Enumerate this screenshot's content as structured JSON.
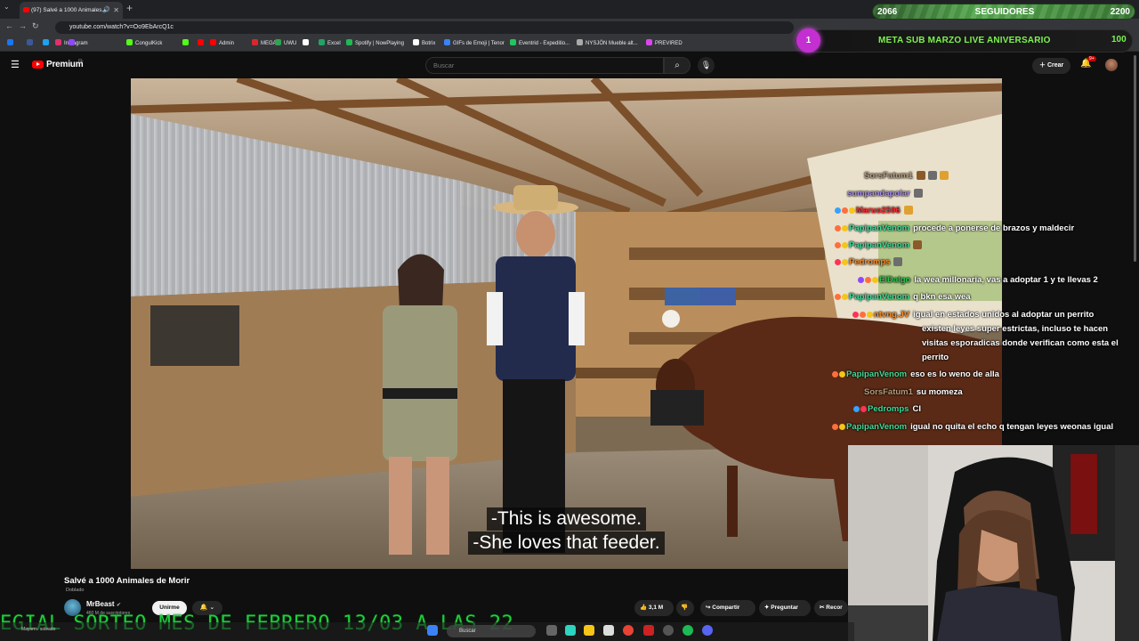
{
  "browser": {
    "tab_title": "(97) Salvé a 1000 Animales...",
    "url": "youtube.com/watch?v=Oo9EbArcQ1c",
    "new_tab": "+",
    "bookmarks": [
      {
        "label": "",
        "color": "#1877f2"
      },
      {
        "label": "",
        "color": "#3b5998"
      },
      {
        "label": "",
        "color": "#1da1f2"
      },
      {
        "label": "Instagram",
        "color": "#e1306c"
      },
      {
        "label": "",
        "color": "#9146ff"
      },
      {
        "label": "CongulKick",
        "color": "#53fc18"
      },
      {
        "label": "",
        "color": "#53fc18"
      },
      {
        "label": "",
        "color": "#ff0000"
      },
      {
        "label": "Admin",
        "color": "#ff0000"
      },
      {
        "label": "MEGA",
        "color": "#d9272e"
      },
      {
        "label": "UWU",
        "color": "#2ea44f"
      },
      {
        "label": "",
        "color": "#ffffff"
      },
      {
        "label": "Excel",
        "color": "#21a366"
      },
      {
        "label": "Spotify | NowPlaying",
        "color": "#1db954"
      },
      {
        "label": "Botrix",
        "color": "#ffffff"
      },
      {
        "label": "GIFs de Emoji | Tenor",
        "color": "#3b82f6"
      },
      {
        "label": "Eventrid - Expeditio...",
        "color": "#22c55e"
      },
      {
        "label": "NYSJÖN Mueble alt...",
        "color": "#aaaaaa"
      },
      {
        "label": "PREVIRED",
        "color": "#d946ef"
      }
    ]
  },
  "youtube": {
    "brand": "Premium",
    "brand_region": "CL",
    "search_placeholder": "Buscar",
    "create_label": "Crear",
    "bell_badge": "9+",
    "video_title": "Salvé a 1000 Animales de Morir",
    "dubbed_label": "Doblado",
    "channel_name": "MrBeast",
    "channel_subs": "460 M de suscriptores",
    "join_label": "Unirme",
    "likes": "3,1 M",
    "share_label": "Compartir",
    "ask_label": "Preguntar",
    "clip_label": "Recor",
    "subtitles": [
      "-This is awesome.",
      "-She loves that feeder."
    ]
  },
  "overlay": {
    "followers_current": "2066",
    "followers_label": "SEGUIDORES",
    "followers_goal": "2200",
    "sub_count": "1",
    "sub_goal_title": "META SUB MARZO LIVE ANIVERSARIO",
    "sub_goal_target": "100",
    "ticker": "EGIAL SORTEO MES DE FEBRERO 13/03 A LAS 22"
  },
  "chat": [
    {
      "name": "SorsFatum1",
      "name_color": "#b59b7c",
      "text": "",
      "emotes": 3,
      "badges": []
    },
    {
      "name": "sumpandapolar",
      "name_color": "#a98be8",
      "text": "",
      "emotes": 1,
      "badges": []
    },
    {
      "name": "Maruo2506",
      "name_color": "#ff2a2a",
      "text": "",
      "emotes": 1,
      "badges": [
        "#35a2ff",
        "#ff6f3c",
        "#f5c518"
      ]
    },
    {
      "name": "PapipanVenom",
      "name_color": "#3ddc9a",
      "text": "procede a ponerse de brazos y maldecir",
      "emotes": 0,
      "badges": [
        "#ff6f3c",
        "#f5c518"
      ]
    },
    {
      "name": "PapipanVenom",
      "name_color": "#3ddc9a",
      "text": "",
      "emotes": 1,
      "badges": [
        "#ff6f3c",
        "#f5c518"
      ]
    },
    {
      "name": "Pedromps",
      "name_color": "#ff8a1f",
      "text": "",
      "emotes": 1,
      "badges": [
        "#ff3355",
        "#f5c518"
      ]
    },
    {
      "name": "ElDalgo",
      "name_color": "#27c64a",
      "text": "la wea millonaria, vas a adoptar 1 y te llevas 2",
      "emotes": 0,
      "badges": [
        "#9146ff",
        "#ff6f3c",
        "#f5c518"
      ]
    },
    {
      "name": "PapipanVenom",
      "name_color": "#3ddc9a",
      "text": "q bkn esa wea",
      "emotes": 0,
      "badges": [
        "#ff6f3c",
        "#f5c518"
      ]
    },
    {
      "name": "ntvng.JV",
      "name_color": "#ff8a1f",
      "text": "igual en estados unidos al adoptar un perrito",
      "emotes": 0,
      "badges": [
        "#ff3355",
        "#ff6f3c",
        "#f5c518"
      ]
    },
    {
      "name": "",
      "name_color": "#ffffff",
      "text": "existen leyes super estrictas, incluso te hacen",
      "emotes": 0,
      "badges": []
    },
    {
      "name": "",
      "name_color": "#ffffff",
      "text": "visitas esporadicas donde verifican como esta el",
      "emotes": 0,
      "badges": []
    },
    {
      "name": "",
      "name_color": "#ffffff",
      "text": "perrito",
      "emotes": 0,
      "badges": []
    },
    {
      "name": "PapipanVenom",
      "name_color": "#3ddc9a",
      "text": "eso es lo weno de alla",
      "emotes": 0,
      "badges": [
        "#ff6f3c",
        "#f5c518"
      ]
    },
    {
      "name": "SorsFatum1",
      "name_color": "#b59b7c",
      "text": "su momeza",
      "emotes": 0,
      "badges": []
    },
    {
      "name": "Pedromps",
      "name_color": "#3ddc9a",
      "text": "CI",
      "emotes": 0,
      "badges": [
        "#35a2ff",
        "#ff3355"
      ]
    },
    {
      "name": "PapipanVenom",
      "name_color": "#3ddc9a",
      "text": "igual no quita el echo q tengan leyes weonas igual",
      "emotes": 0,
      "badges": [
        "#ff6f3c",
        "#f5c518"
      ]
    }
  ],
  "taskbar": {
    "search_label": "Buscar",
    "weather": "Mayorm. soleado"
  },
  "colors": {
    "yt_red": "#ff0000",
    "sub_goal_green": "#7df24f",
    "ticker_green": "#1dcf3c",
    "sub_circle": "#c32fd0"
  }
}
